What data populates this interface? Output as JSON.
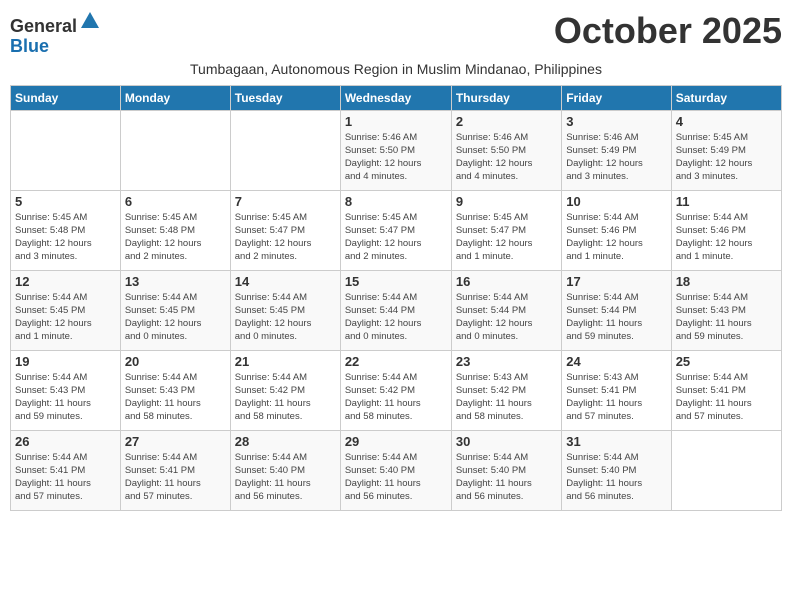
{
  "header": {
    "logo_general": "General",
    "logo_blue": "Blue",
    "month_title": "October 2025",
    "subtitle": "Tumbagaan, Autonomous Region in Muslim Mindanao, Philippines"
  },
  "days_of_week": [
    "Sunday",
    "Monday",
    "Tuesday",
    "Wednesday",
    "Thursday",
    "Friday",
    "Saturday"
  ],
  "weeks": [
    [
      {
        "day": "",
        "info": ""
      },
      {
        "day": "",
        "info": ""
      },
      {
        "day": "",
        "info": ""
      },
      {
        "day": "1",
        "info": "Sunrise: 5:46 AM\nSunset: 5:50 PM\nDaylight: 12 hours\nand 4 minutes."
      },
      {
        "day": "2",
        "info": "Sunrise: 5:46 AM\nSunset: 5:50 PM\nDaylight: 12 hours\nand 4 minutes."
      },
      {
        "day": "3",
        "info": "Sunrise: 5:46 AM\nSunset: 5:49 PM\nDaylight: 12 hours\nand 3 minutes."
      },
      {
        "day": "4",
        "info": "Sunrise: 5:45 AM\nSunset: 5:49 PM\nDaylight: 12 hours\nand 3 minutes."
      }
    ],
    [
      {
        "day": "5",
        "info": "Sunrise: 5:45 AM\nSunset: 5:48 PM\nDaylight: 12 hours\nand 3 minutes."
      },
      {
        "day": "6",
        "info": "Sunrise: 5:45 AM\nSunset: 5:48 PM\nDaylight: 12 hours\nand 2 minutes."
      },
      {
        "day": "7",
        "info": "Sunrise: 5:45 AM\nSunset: 5:47 PM\nDaylight: 12 hours\nand 2 minutes."
      },
      {
        "day": "8",
        "info": "Sunrise: 5:45 AM\nSunset: 5:47 PM\nDaylight: 12 hours\nand 2 minutes."
      },
      {
        "day": "9",
        "info": "Sunrise: 5:45 AM\nSunset: 5:47 PM\nDaylight: 12 hours\nand 1 minute."
      },
      {
        "day": "10",
        "info": "Sunrise: 5:44 AM\nSunset: 5:46 PM\nDaylight: 12 hours\nand 1 minute."
      },
      {
        "day": "11",
        "info": "Sunrise: 5:44 AM\nSunset: 5:46 PM\nDaylight: 12 hours\nand 1 minute."
      }
    ],
    [
      {
        "day": "12",
        "info": "Sunrise: 5:44 AM\nSunset: 5:45 PM\nDaylight: 12 hours\nand 1 minute."
      },
      {
        "day": "13",
        "info": "Sunrise: 5:44 AM\nSunset: 5:45 PM\nDaylight: 12 hours\nand 0 minutes."
      },
      {
        "day": "14",
        "info": "Sunrise: 5:44 AM\nSunset: 5:45 PM\nDaylight: 12 hours\nand 0 minutes."
      },
      {
        "day": "15",
        "info": "Sunrise: 5:44 AM\nSunset: 5:44 PM\nDaylight: 12 hours\nand 0 minutes."
      },
      {
        "day": "16",
        "info": "Sunrise: 5:44 AM\nSunset: 5:44 PM\nDaylight: 12 hours\nand 0 minutes."
      },
      {
        "day": "17",
        "info": "Sunrise: 5:44 AM\nSunset: 5:44 PM\nDaylight: 11 hours\nand 59 minutes."
      },
      {
        "day": "18",
        "info": "Sunrise: 5:44 AM\nSunset: 5:43 PM\nDaylight: 11 hours\nand 59 minutes."
      }
    ],
    [
      {
        "day": "19",
        "info": "Sunrise: 5:44 AM\nSunset: 5:43 PM\nDaylight: 11 hours\nand 59 minutes."
      },
      {
        "day": "20",
        "info": "Sunrise: 5:44 AM\nSunset: 5:43 PM\nDaylight: 11 hours\nand 58 minutes."
      },
      {
        "day": "21",
        "info": "Sunrise: 5:44 AM\nSunset: 5:42 PM\nDaylight: 11 hours\nand 58 minutes."
      },
      {
        "day": "22",
        "info": "Sunrise: 5:44 AM\nSunset: 5:42 PM\nDaylight: 11 hours\nand 58 minutes."
      },
      {
        "day": "23",
        "info": "Sunrise: 5:43 AM\nSunset: 5:42 PM\nDaylight: 11 hours\nand 58 minutes."
      },
      {
        "day": "24",
        "info": "Sunrise: 5:43 AM\nSunset: 5:41 PM\nDaylight: 11 hours\nand 57 minutes."
      },
      {
        "day": "25",
        "info": "Sunrise: 5:44 AM\nSunset: 5:41 PM\nDaylight: 11 hours\nand 57 minutes."
      }
    ],
    [
      {
        "day": "26",
        "info": "Sunrise: 5:44 AM\nSunset: 5:41 PM\nDaylight: 11 hours\nand 57 minutes."
      },
      {
        "day": "27",
        "info": "Sunrise: 5:44 AM\nSunset: 5:41 PM\nDaylight: 11 hours\nand 57 minutes."
      },
      {
        "day": "28",
        "info": "Sunrise: 5:44 AM\nSunset: 5:40 PM\nDaylight: 11 hours\nand 56 minutes."
      },
      {
        "day": "29",
        "info": "Sunrise: 5:44 AM\nSunset: 5:40 PM\nDaylight: 11 hours\nand 56 minutes."
      },
      {
        "day": "30",
        "info": "Sunrise: 5:44 AM\nSunset: 5:40 PM\nDaylight: 11 hours\nand 56 minutes."
      },
      {
        "day": "31",
        "info": "Sunrise: 5:44 AM\nSunset: 5:40 PM\nDaylight: 11 hours\nand 56 minutes."
      },
      {
        "day": "",
        "info": ""
      }
    ]
  ]
}
